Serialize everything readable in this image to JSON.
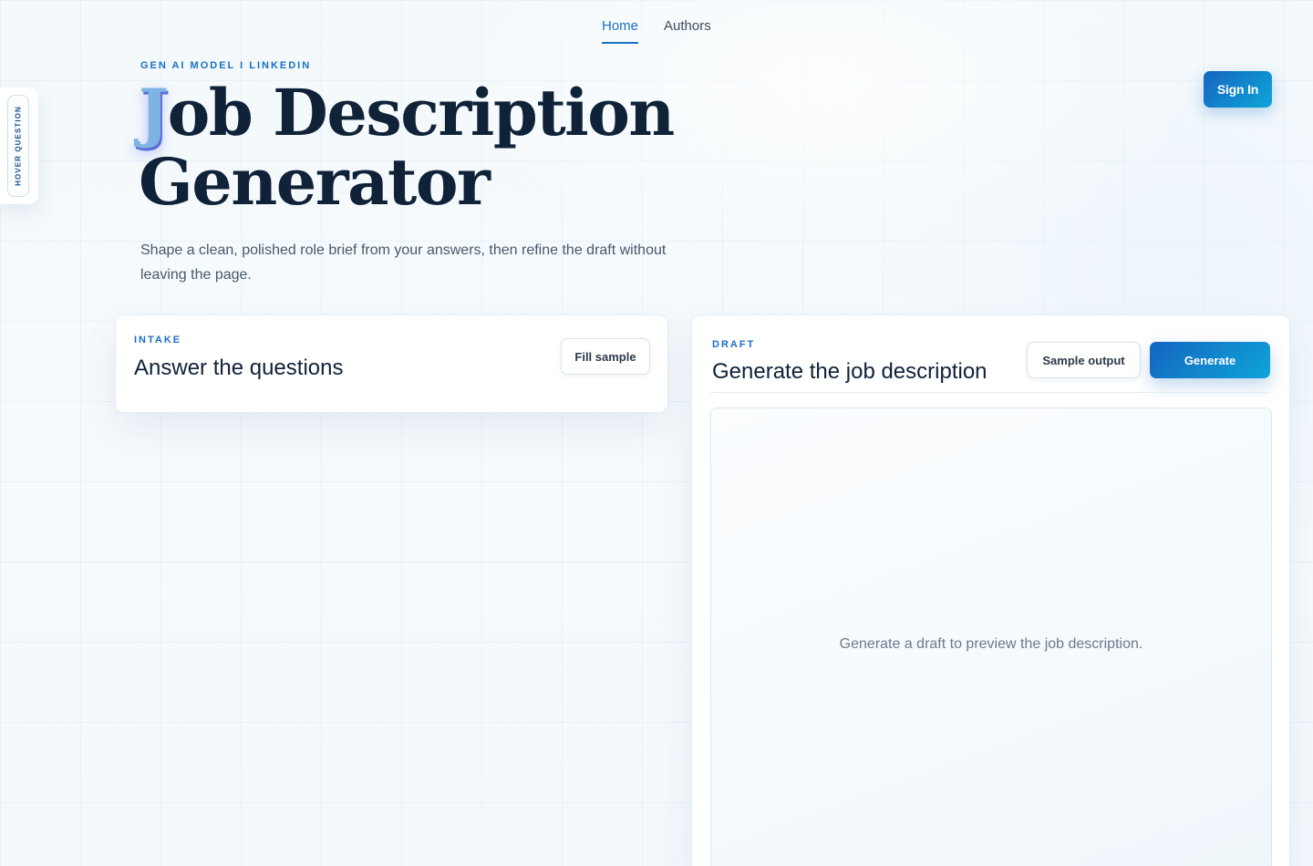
{
  "nav": {
    "items": [
      {
        "label": "Home",
        "active": true
      },
      {
        "label": "Authors",
        "active": false
      }
    ]
  },
  "signin": {
    "label": "Sign In"
  },
  "side_tab": {
    "label": "HOVER QUESTION"
  },
  "hero": {
    "eyebrow": "GEN AI MODEL I LINKEDIN",
    "title_first_letter": "J",
    "title_line1_rest": "ob Description",
    "title_line2": "Generator",
    "subtitle": "Shape a clean, polished role brief from your answers, then refine the draft without leaving the page."
  },
  "intake": {
    "kicker": "INTAKE",
    "title": "Answer the questions",
    "fill_sample_label": "Fill sample"
  },
  "draft": {
    "kicker": "DRAFT",
    "title": "Generate the job description",
    "sample_output_label": "Sample output",
    "generate_label": "Generate",
    "preview_placeholder": "Generate a draft to preview the job description."
  },
  "colors": {
    "accent": "#1a6fc4",
    "heading": "#0f2238",
    "button_gradient_start": "#1565c0",
    "button_gradient_end": "#0ea5d8"
  }
}
